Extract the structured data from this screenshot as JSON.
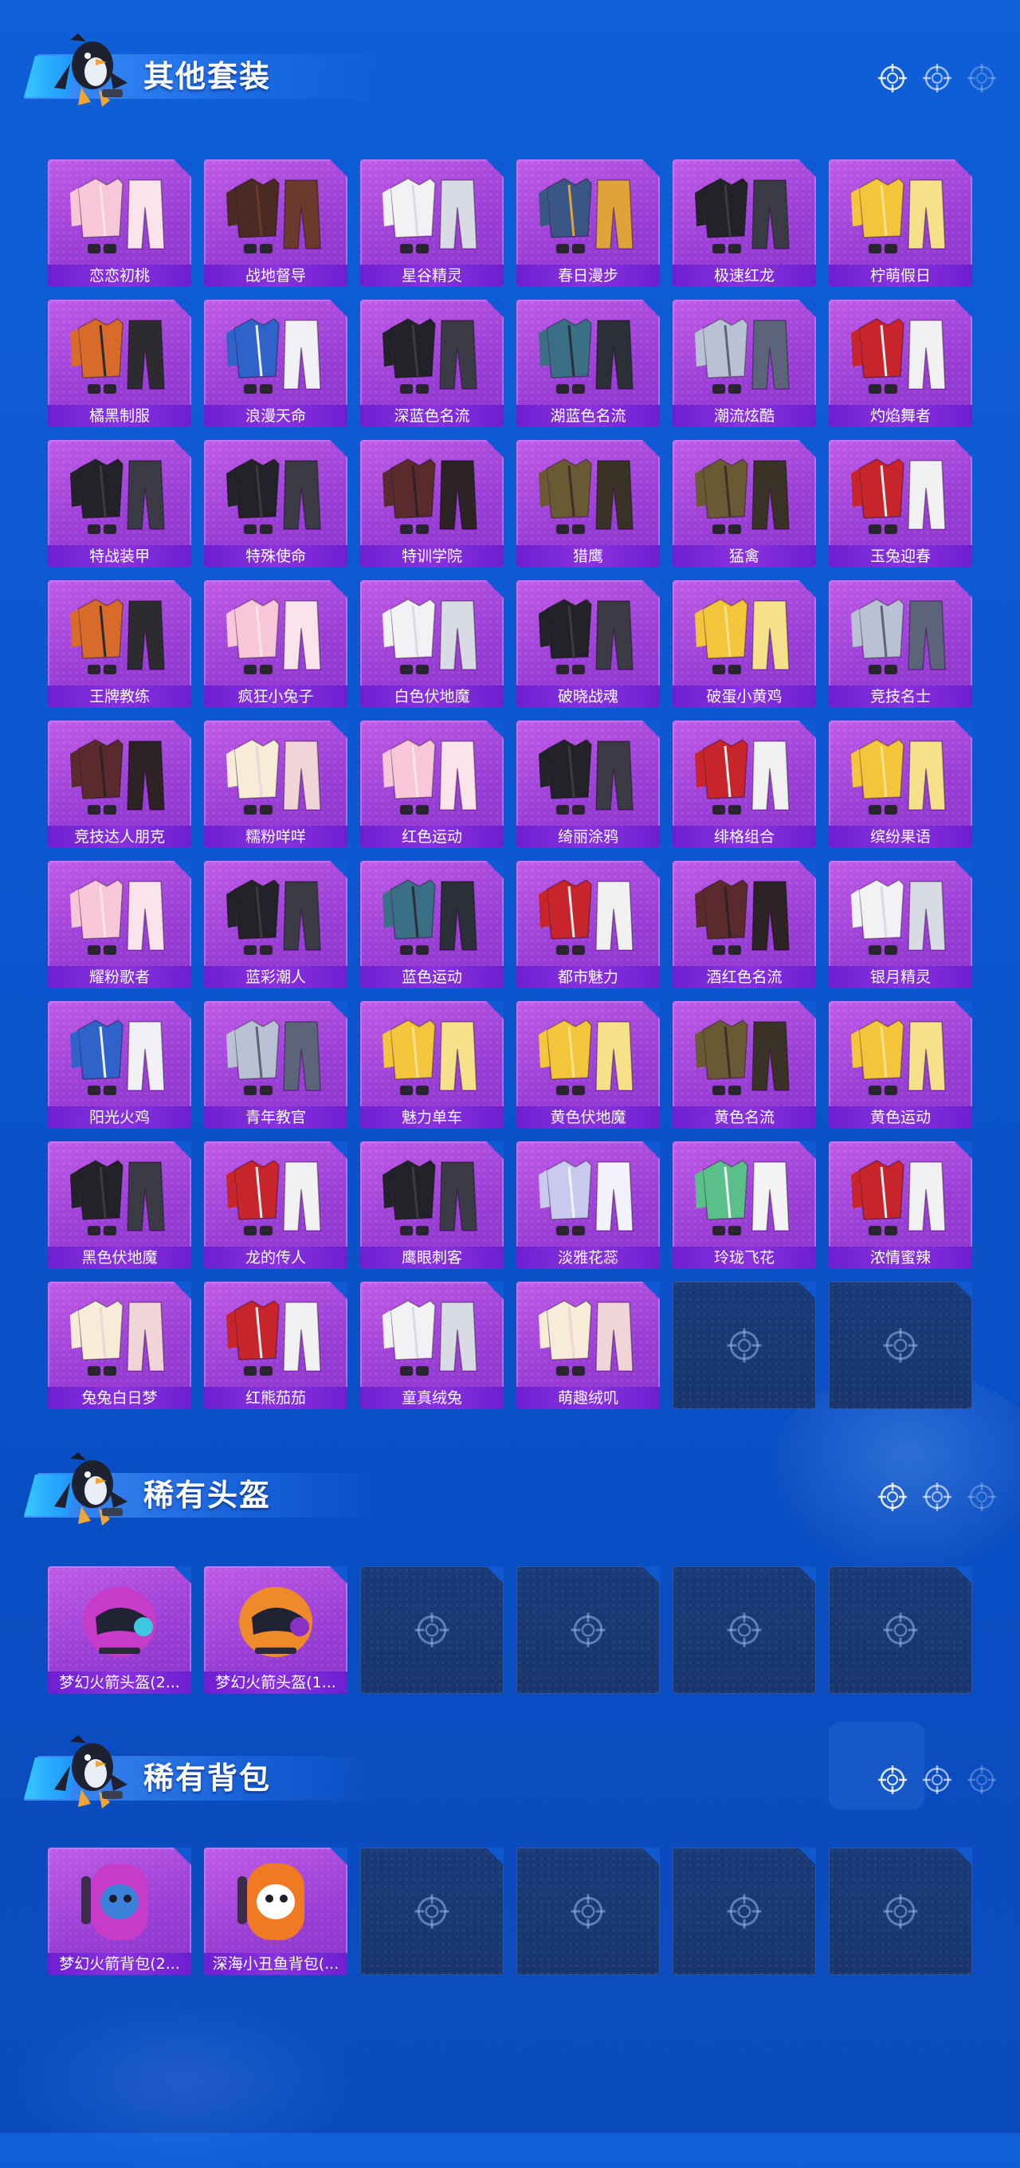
{
  "colors": {
    "background": "#0c56cf",
    "card_purple": "#9b3fd6",
    "card_label": "#7a28d8",
    "empty_slot": "#1a3a78",
    "title_text": "#ffffff"
  },
  "icons": {
    "mascot": "penguin-mascot-icon",
    "target": "crosshair-icon",
    "empty_slot": "crosshair-icon"
  },
  "sections": [
    {
      "title": "其他套装",
      "items": [
        {
          "label": "恋恋初桃",
          "art": "pink"
        },
        {
          "label": "战地督导",
          "art": "brown"
        },
        {
          "label": "星谷精灵",
          "art": "white"
        },
        {
          "label": "春日漫步",
          "art": "denim"
        },
        {
          "label": "极速红龙",
          "art": "black"
        },
        {
          "label": "柠萌假日",
          "art": "yellow"
        },
        {
          "label": "橘黑制服",
          "art": "orange"
        },
        {
          "label": "浪漫天命",
          "art": "blue"
        },
        {
          "label": "深蓝色名流",
          "art": "black"
        },
        {
          "label": "湖蓝色名流",
          "art": "teal"
        },
        {
          "label": "潮流炫酷",
          "art": "silver"
        },
        {
          "label": "灼焰舞者",
          "art": "red"
        },
        {
          "label": "特战装甲",
          "art": "black"
        },
        {
          "label": "特殊使命",
          "art": "black"
        },
        {
          "label": "特训学院",
          "art": "maroon"
        },
        {
          "label": "猎鹰",
          "art": "olive"
        },
        {
          "label": "猛禽",
          "art": "olive"
        },
        {
          "label": "玉兔迎春",
          "art": "red"
        },
        {
          "label": "王牌教练",
          "art": "orange"
        },
        {
          "label": "疯狂小兔子",
          "art": "pink"
        },
        {
          "label": "白色伏地魔",
          "art": "white"
        },
        {
          "label": "破晓战魂",
          "art": "black"
        },
        {
          "label": "破蛋小黄鸡",
          "art": "yellow"
        },
        {
          "label": "竞技名士",
          "art": "silver"
        },
        {
          "label": "竞技达人朋克",
          "art": "maroon"
        },
        {
          "label": "糯粉咩咩",
          "art": "cream"
        },
        {
          "label": "红色运动",
          "art": "pink"
        },
        {
          "label": "绮丽涂鸦",
          "art": "black"
        },
        {
          "label": "绯格组合",
          "art": "red"
        },
        {
          "label": "缤纷果语",
          "art": "yellow"
        },
        {
          "label": "耀粉歌者",
          "art": "pink"
        },
        {
          "label": "蓝彩潮人",
          "art": "black"
        },
        {
          "label": "蓝色运动",
          "art": "teal"
        },
        {
          "label": "都市魅力",
          "art": "red"
        },
        {
          "label": "酒红色名流",
          "art": "maroon"
        },
        {
          "label": "银月精灵",
          "art": "white"
        },
        {
          "label": "阳光火鸡",
          "art": "blue"
        },
        {
          "label": "青年教官",
          "art": "silver"
        },
        {
          "label": "魅力单车",
          "art": "yellow"
        },
        {
          "label": "黄色伏地魔",
          "art": "yellow"
        },
        {
          "label": "黄色名流",
          "art": "olive"
        },
        {
          "label": "黄色运动",
          "art": "yellow"
        },
        {
          "label": "黑色伏地魔",
          "art": "black"
        },
        {
          "label": "龙的传人",
          "art": "red"
        },
        {
          "label": "鹰眼刺客",
          "art": "black"
        },
        {
          "label": "淡雅花蕊",
          "art": "lavender"
        },
        {
          "label": "玲珑飞花",
          "art": "green"
        },
        {
          "label": "浓情蜜辣",
          "art": "red"
        },
        {
          "label": "兔兔白日梦",
          "art": "cream"
        },
        {
          "label": "红熊茄茄",
          "art": "red"
        },
        {
          "label": "童真绒兔",
          "art": "white"
        },
        {
          "label": "萌趣绒叽",
          "art": "cream"
        }
      ],
      "empty_slots": 2
    },
    {
      "title": "稀有头盔",
      "items": [
        {
          "label": "梦幻火箭头盔(2...",
          "art": "helmet-pink"
        },
        {
          "label": "梦幻火箭头盔(1...",
          "art": "helmet-orange"
        }
      ],
      "empty_slots": 4
    },
    {
      "title": "稀有背包",
      "items": [
        {
          "label": "梦幻火箭背包(2...",
          "art": "backpack-pink"
        },
        {
          "label": "深海小丑鱼背包(...",
          "art": "backpack-orange"
        }
      ],
      "empty_slots": 4
    }
  ]
}
